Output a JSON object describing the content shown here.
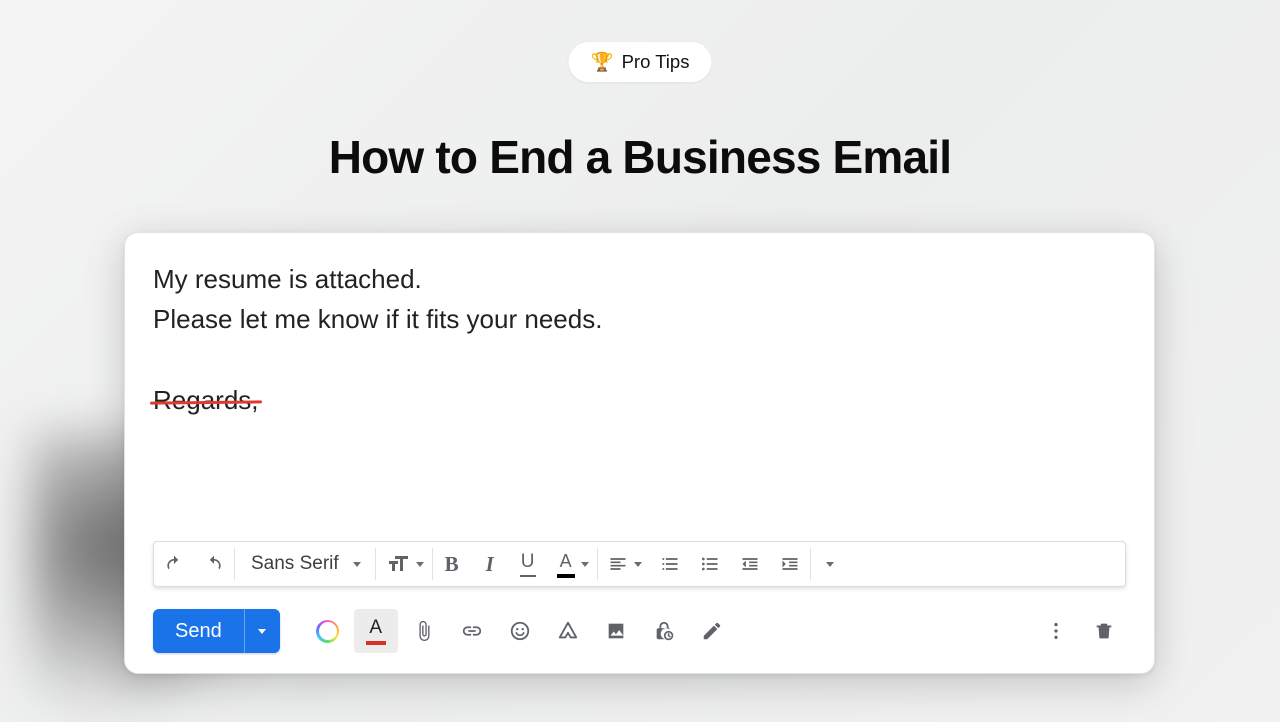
{
  "badge": {
    "icon": "🏆",
    "label": "Pro Tips"
  },
  "title": "How to End a Business Email",
  "compose": {
    "body": {
      "line1": "My resume is attached.",
      "line2": "Please let me know if it fits your needs.",
      "struck": "Regards,"
    },
    "format_bar": {
      "font": "Sans Serif"
    },
    "send_label": "Send"
  }
}
